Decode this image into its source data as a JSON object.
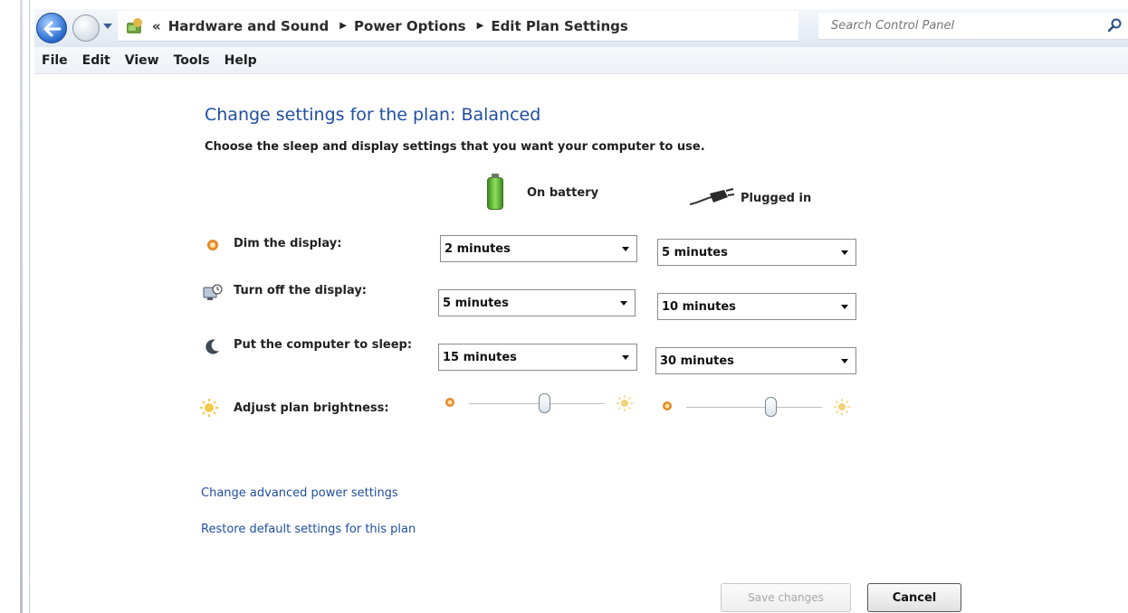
{
  "address_bar": {
    "overflow_label": "«",
    "breadcrumbs": [
      "Hardware and Sound",
      "Power Options",
      "Edit Plan Settings"
    ],
    "search_placeholder": "Search Control Panel"
  },
  "menu": {
    "items": [
      "File",
      "Edit",
      "View",
      "Tools",
      "Help"
    ]
  },
  "main": {
    "title": "Change settings for the plan: Balanced",
    "subtitle": "Choose the sleep and display settings that you want your computer to use.",
    "columns": {
      "battery": "On battery",
      "plugged": "Plugged in"
    },
    "rows": [
      {
        "label": "Dim the display:",
        "battery": "2 minutes",
        "plugged": "5 minutes"
      },
      {
        "label": "Turn off the display:",
        "battery": "5 minutes",
        "plugged": "10 minutes"
      },
      {
        "label": "Put the computer to sleep:",
        "battery": "15 minutes",
        "plugged": "30 minutes"
      }
    ],
    "brightness": {
      "label": "Adjust plan brightness:",
      "battery_level": 0.55,
      "plugged_level": 0.62
    },
    "links": {
      "advanced": "Change advanced power settings",
      "restore": "Restore default settings for this plan"
    },
    "buttons": {
      "save": "Save changes",
      "cancel": "Cancel"
    }
  },
  "colors": {
    "link": "#1f4ea1",
    "accent": "#2d6fd1"
  }
}
